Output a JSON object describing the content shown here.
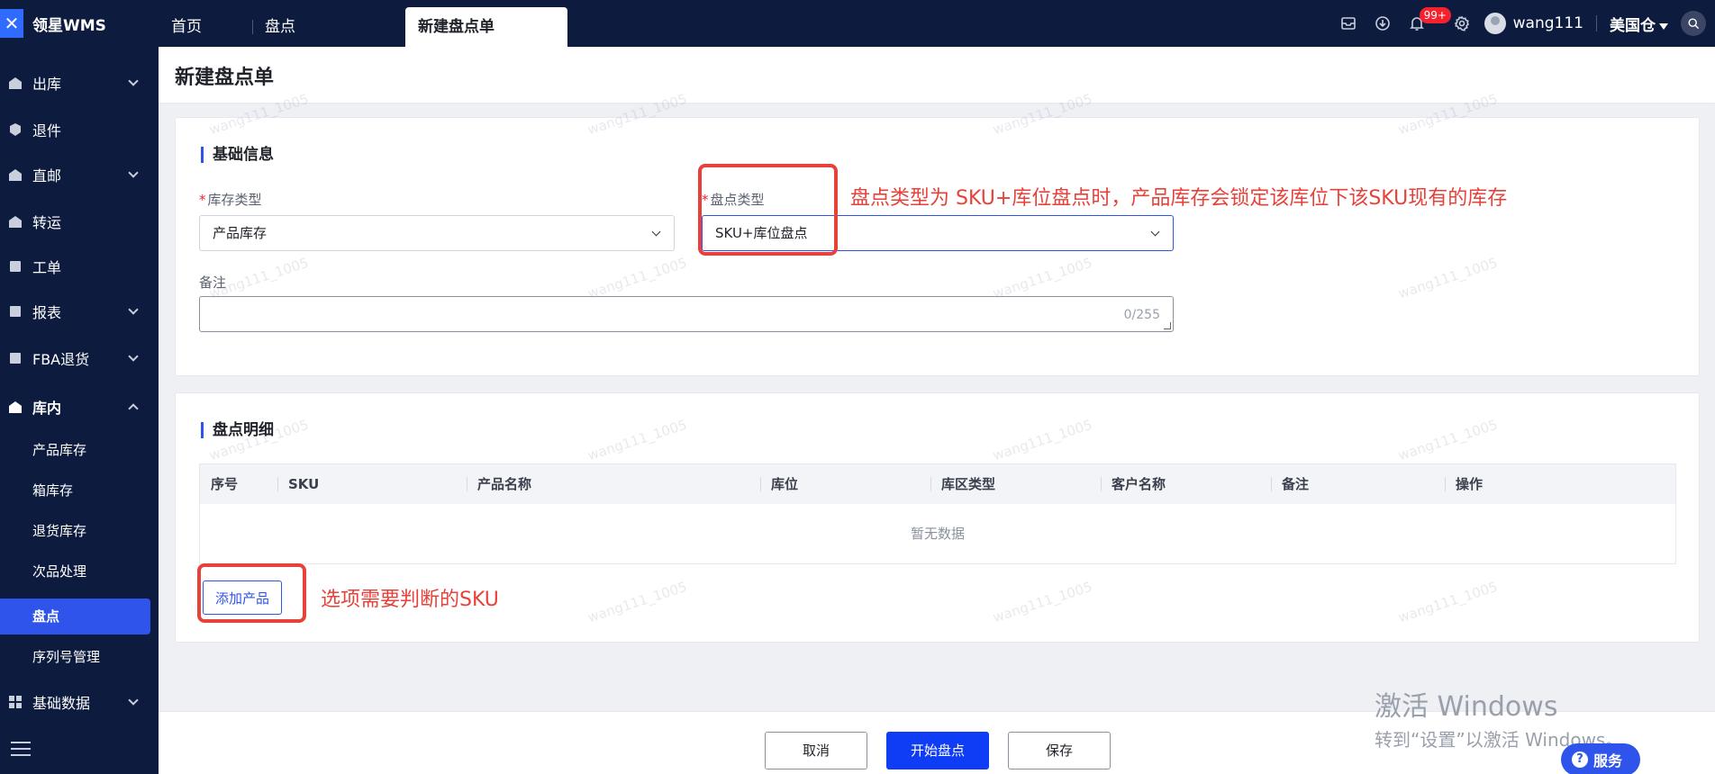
{
  "app": {
    "logo_text": "领星WMS"
  },
  "tabs": [
    {
      "label": "首页"
    },
    {
      "label": "盘点"
    },
    {
      "label": "新建盘点单"
    }
  ],
  "topbar": {
    "notification_badge": "99+",
    "username": "wang111",
    "warehouse": "美国仓"
  },
  "sidebar": {
    "items": [
      {
        "label": "出库",
        "icon": "outbound-icon"
      },
      {
        "label": "退件",
        "icon": "return-icon"
      },
      {
        "label": "直邮",
        "icon": "direct-mail-icon"
      },
      {
        "label": "转运",
        "icon": "transfer-icon"
      },
      {
        "label": "工单",
        "icon": "work-order-icon"
      },
      {
        "label": "报表",
        "icon": "report-icon"
      },
      {
        "label": "FBA退货",
        "icon": "fba-icon"
      },
      {
        "label": "库内",
        "icon": "warehouse-icon"
      },
      {
        "label": "基础数据",
        "icon": "base-data-icon"
      }
    ],
    "sub_items": [
      {
        "label": "产品库存"
      },
      {
        "label": "箱库存"
      },
      {
        "label": "退货库存"
      },
      {
        "label": "次品处理"
      },
      {
        "label": "盘点"
      },
      {
        "label": "序列号管理"
      }
    ]
  },
  "page": {
    "title": "新建盘点单"
  },
  "basic_info": {
    "section_title": "基础信息",
    "inventory_type_label": "库存类型",
    "inventory_type_value": "产品库存",
    "count_type_label": "盘点类型",
    "count_type_value": "SKU+库位盘点",
    "remark_label": "备注",
    "remark_count": "0/255"
  },
  "details": {
    "section_title": "盘点明细",
    "columns": [
      "序号",
      "SKU",
      "产品名称",
      "库位",
      "库区类型",
      "客户名称",
      "备注",
      "操作"
    ],
    "empty_text": "暂无数据",
    "add_button": "添加产品"
  },
  "annotations": {
    "count_type_note": "盘点类型为 SKU+库位盘点时，产品库存会锁定该库位下该SKU现有的库存",
    "add_product_note": "选项需要判断的SKU"
  },
  "footer": {
    "cancel": "取消",
    "start": "开始盘点",
    "save": "保存"
  },
  "overlay": {
    "activate_line1": "激活 Windows",
    "activate_line2": "转到“设置”以激活 Windows。",
    "service": "服务",
    "watermark": "wang111_1005"
  },
  "colors": {
    "nav_bg": "#0d1b3e",
    "primary": "#2f54eb",
    "primary_button": "#0f3cf5",
    "annotation_red": "#e8413a",
    "badge_red": "#f5222d"
  }
}
